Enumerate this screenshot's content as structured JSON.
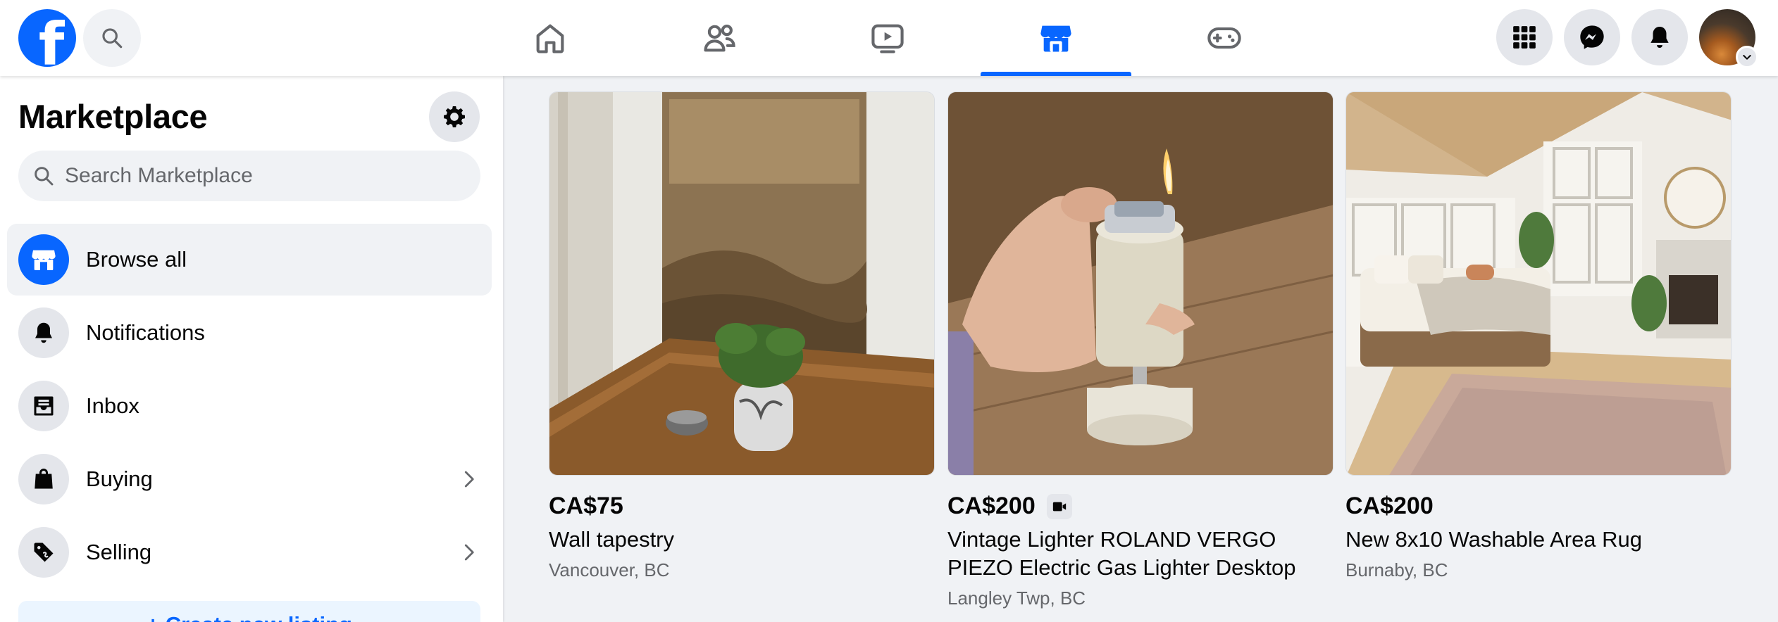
{
  "topbar": {
    "logo_letter": "f",
    "nav": [
      "home-icon",
      "friends-icon",
      "watch-icon",
      "marketplace-icon",
      "gaming-icon"
    ],
    "active_tab": "marketplace",
    "accent": "#0866ff"
  },
  "sidebar": {
    "title": "Marketplace",
    "search_placeholder": "Search Marketplace",
    "items": [
      {
        "label": "Browse all",
        "icon": "storefront-icon",
        "active": true
      },
      {
        "label": "Notifications",
        "icon": "bell-icon"
      },
      {
        "label": "Inbox",
        "icon": "inbox-icon"
      },
      {
        "label": "Buying",
        "icon": "shopping-bag-icon"
      },
      {
        "label": "Selling",
        "icon": "price-tag-icon"
      }
    ],
    "create_label": "+ Create new listing"
  },
  "listings": [
    {
      "price": "CA$75",
      "title": "Wall tapestry",
      "location": "Vancouver, BC",
      "has_video": false
    },
    {
      "price": "CA$200",
      "title": "Vintage Lighter ROLAND VERGO PIEZO Electric Gas Lighter Desktop Japan...",
      "location": "Langley Twp, BC",
      "has_video": true
    },
    {
      "price": "CA$200",
      "title": "New 8x10 Washable Area Rug",
      "location": "Burnaby, BC",
      "has_video": false
    }
  ]
}
